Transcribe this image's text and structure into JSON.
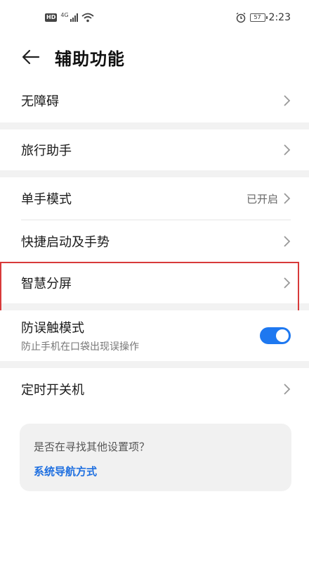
{
  "status_bar": {
    "hd": "HD",
    "network": "4G",
    "battery": "57",
    "time": "2:23"
  },
  "header": {
    "title": "辅助功能"
  },
  "list": {
    "accessibility": {
      "label": "无障碍"
    },
    "travel_assistant": {
      "label": "旅行助手"
    },
    "one_hand_mode": {
      "label": "单手模式",
      "value": "已开启"
    },
    "quick_launch": {
      "label": "快捷启动及手势"
    },
    "smart_split": {
      "label": "智慧分屏"
    },
    "accidental_touch": {
      "label": "防误触模式",
      "sub": "防止手机在口袋出现误操作",
      "enabled": true
    },
    "scheduled_power": {
      "label": "定时开关机"
    }
  },
  "help_card": {
    "question": "是否在寻找其他设置项？",
    "link": "系统导航方式"
  },
  "colors": {
    "accent": "#1e78f0",
    "highlight": "#d83a3a"
  }
}
